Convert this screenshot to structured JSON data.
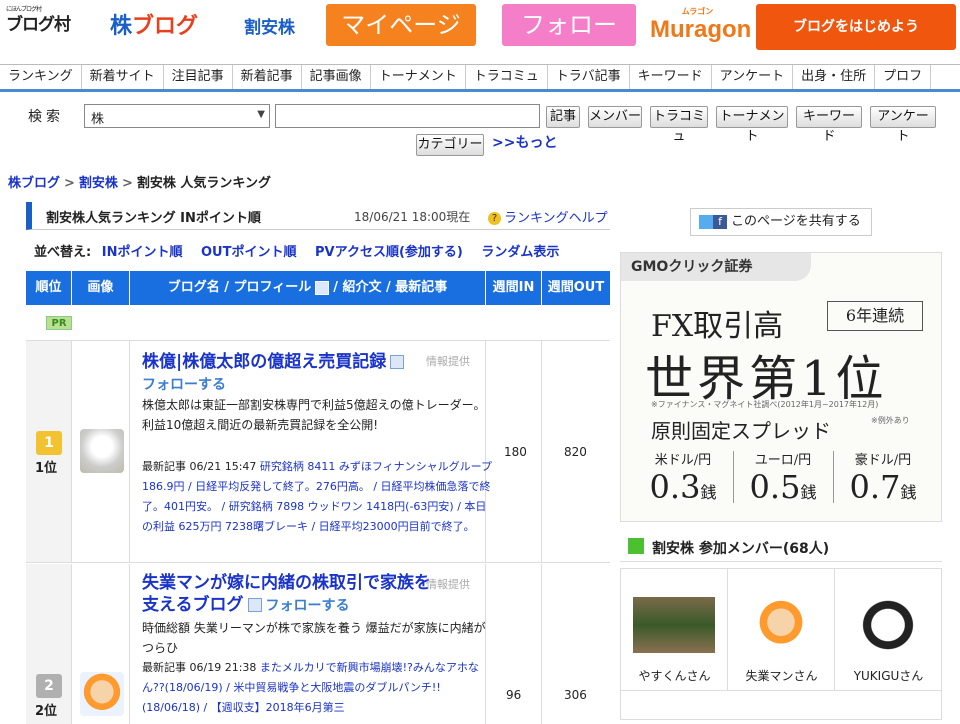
{
  "header": {
    "logo_mura_small": "にほんブログ村",
    "logo_mura": "ブログ村",
    "logo_kabu_a": "株",
    "logo_kabu_b": "ブログ",
    "logo_wariyasu": "割安株",
    "mypage": "マイページ",
    "follow": "フォロー",
    "muragon_small": "ムラゴン",
    "muragon": "Muragon",
    "start_blog": "ブログをはじめよう"
  },
  "nav": [
    "ランキング",
    "新着サイト",
    "注目記事",
    "新着記事",
    "記事画像",
    "トーナメント",
    "トラコミュ",
    "トラバ記事",
    "キーワード",
    "アンケート",
    "出身・住所",
    "プロフ"
  ],
  "search": {
    "label": "検索",
    "select_value": "株",
    "input_value": "",
    "buttons": [
      "記事",
      "メンバー",
      "トラコミュ",
      "トーナメント",
      "キーワード",
      "アンケート"
    ],
    "category": "カテゴリー",
    "more": ">>もっと"
  },
  "breadcrumb": {
    "a": "株ブログ",
    "b": "割安株",
    "current": "割安株 人気ランキング",
    "sep": ">"
  },
  "ranking": {
    "title": "割安株人気ランキング INポイント順",
    "date": "18/06/21 18:00現在",
    "help": "ランキングヘルプ",
    "sort_label": "並べ替え:",
    "sort_options": [
      "INポイント順",
      "OUTポイント順",
      "PVアクセス順(参加する)",
      "ランダム表示"
    ],
    "columns": {
      "rank": "順位",
      "image": "画像",
      "name": "ブログ名 / プロフィール",
      "name_tail": "/ 紹介文 / 最新記事",
      "in": "週間IN",
      "out": "週間OUT"
    },
    "pr": "PR",
    "info_label": "情報提供",
    "follow_label": "フォローする",
    "latest_label": "最新記事",
    "entries": [
      {
        "rank_icon": "1",
        "rank": "1位",
        "title": "株億|株億太郎の億超え売買記録",
        "intro": "株億太郎は東証一部割安株専門で利益5億超えの億トレーダー。利益10億超え間近の最新売買記録を全公開!",
        "latest_time": "06/21 15:47",
        "latest": "研究銘柄 8411 みずほフィナンシャルグループ 186.9円 / 日経平均反発して終了。276円高。 / 日経平均株価急落で終了。401円安。 / 研究銘柄 7898 ウッドワン 1418円(-63円安) / 本日の利益 625万円 7238曙ブレーキ / 日経平均23000円目前で終了。",
        "in": "180",
        "out": "820"
      },
      {
        "rank_icon": "2",
        "rank": "2位",
        "title": "失業マンが嫁に内緒の株取引で家族を支えるブログ",
        "intro": "時価総額 失業リーマンが株で家族を養う 爆益だが家族に内緒がつらひ",
        "latest_time": "06/19 21:38",
        "latest": "またメルカリで新興市場崩壊!?みんなアホなん??(18/06/19) / 米中貿易戦争と大阪地震のダブルパンチ!!(18/06/18) / 【週収支】2018年6月第三",
        "in": "96",
        "out": "306"
      }
    ]
  },
  "share": "このページを共有する",
  "ad": {
    "brand": "GMOクリック証券",
    "line1": "FX取引高",
    "badge": "6年連続",
    "line2": "世界第1位",
    "source": "※ファイナンス・マグネイト社調べ(2012年1月~2017年12月)",
    "line3": "原則固定スプレッド",
    "exception": "※例外あり",
    "pairs": [
      {
        "name": "米ドル/円",
        "value": "0.3",
        "unit": "銭"
      },
      {
        "name": "ユーロ/円",
        "value": "0.5",
        "unit": "銭"
      },
      {
        "name": "豪ドル/円",
        "value": "0.7",
        "unit": "銭"
      }
    ]
  },
  "members": {
    "title": "割安株 参加メンバー(68人)",
    "list": [
      "やすくんさん",
      "失業マンさん",
      "YUKIGUさん"
    ]
  }
}
